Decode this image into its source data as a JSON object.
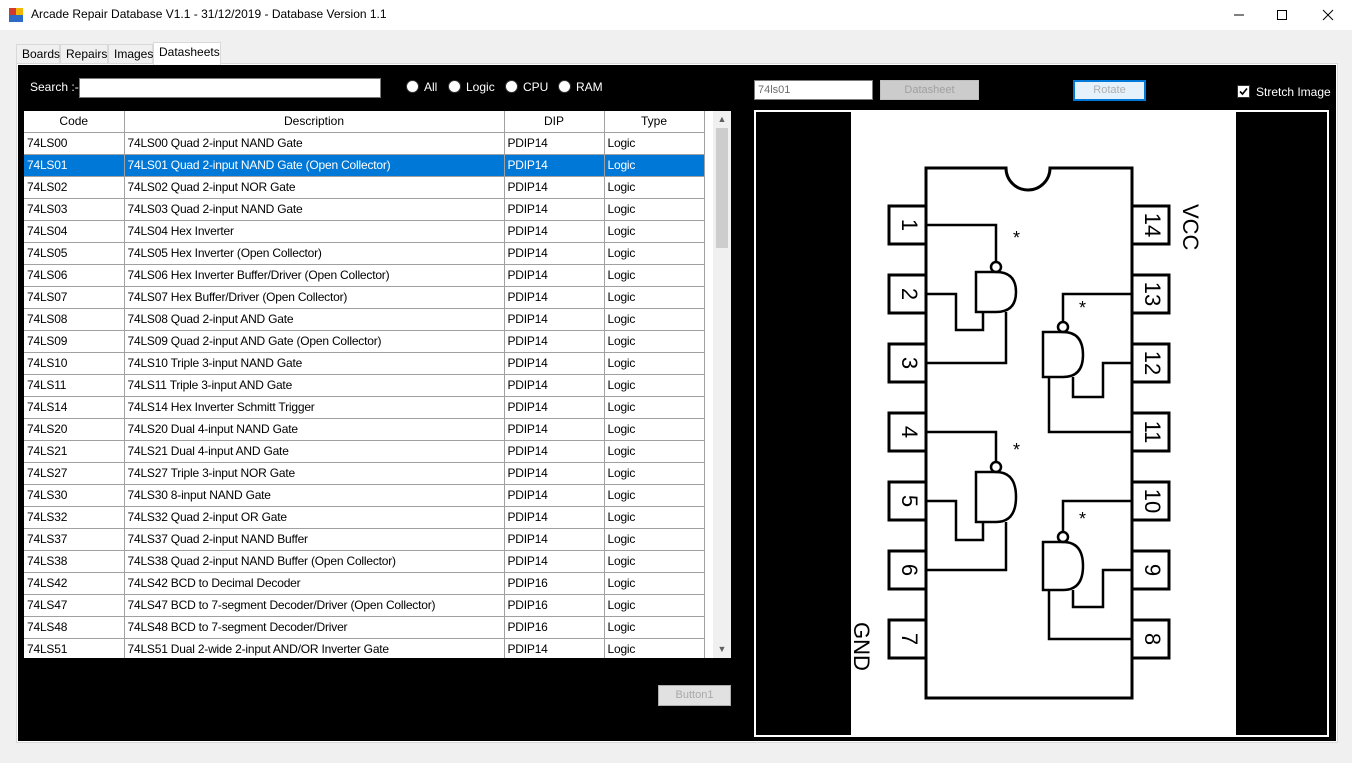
{
  "window": {
    "title": "Arcade Repair Database V1.1 - 31/12/2019 - Database Version 1.1",
    "minimize_glyph": "—",
    "maximize_glyph": "☐",
    "close_glyph": "✕"
  },
  "tabs": [
    {
      "label": "Boards",
      "active": false
    },
    {
      "label": "Repairs",
      "active": false
    },
    {
      "label": "Images",
      "active": false
    },
    {
      "label": "Datasheets",
      "active": true
    }
  ],
  "search": {
    "label": "Search :-",
    "value": ""
  },
  "filters": [
    {
      "label": "All",
      "checked": false
    },
    {
      "label": "Logic",
      "checked": false
    },
    {
      "label": "CPU",
      "checked": false
    },
    {
      "label": "RAM",
      "checked": false
    }
  ],
  "grid": {
    "columns": [
      "Code",
      "Description",
      "DIP",
      "Type"
    ],
    "selected_index": 1,
    "rows": [
      [
        "74LS00",
        "74LS00 Quad 2-input NAND Gate",
        "PDIP14",
        "Logic"
      ],
      [
        "74LS01",
        "74LS01 Quad 2-input NAND Gate (Open Collector)",
        "PDIP14",
        "Logic"
      ],
      [
        "74LS02",
        "74LS02 Quad 2-input NOR Gate",
        "PDIP14",
        "Logic"
      ],
      [
        "74LS03",
        "74LS03 Quad 2-input NAND Gate",
        "PDIP14",
        "Logic"
      ],
      [
        "74LS04",
        "74LS04 Hex Inverter",
        "PDIP14",
        "Logic"
      ],
      [
        "74LS05",
        "74LS05 Hex Inverter (Open Collector)",
        "PDIP14",
        "Logic"
      ],
      [
        "74LS06",
        "74LS06 Hex Inverter Buffer/Driver (Open Collector)",
        "PDIP14",
        "Logic"
      ],
      [
        "74LS07",
        "74LS07 Hex Buffer/Driver (Open Collector)",
        "PDIP14",
        "Logic"
      ],
      [
        "74LS08",
        "74LS08 Quad 2-input AND Gate",
        "PDIP14",
        "Logic"
      ],
      [
        "74LS09",
        "74LS09 Quad 2-input AND Gate (Open Collector)",
        "PDIP14",
        "Logic"
      ],
      [
        "74LS10",
        "74LS10 Triple 3-input NAND Gate",
        "PDIP14",
        "Logic"
      ],
      [
        "74LS11",
        "74LS11 Triple 3-input AND Gate",
        "PDIP14",
        "Logic"
      ],
      [
        "74LS14",
        "74LS14 Hex Inverter Schmitt Trigger",
        "PDIP14",
        "Logic"
      ],
      [
        "74LS20",
        "74LS20 Dual 4-input NAND Gate",
        "PDIP14",
        "Logic"
      ],
      [
        "74LS21",
        "74LS21 Dual 4-input AND Gate",
        "PDIP14",
        "Logic"
      ],
      [
        "74LS27",
        "74LS27 Triple 3-input NOR Gate",
        "PDIP14",
        "Logic"
      ],
      [
        "74LS30",
        "74LS30 8-input NAND Gate",
        "PDIP14",
        "Logic"
      ],
      [
        "74LS32",
        "74LS32 Quad 2-input OR Gate",
        "PDIP14",
        "Logic"
      ],
      [
        "74LS37",
        "74LS37 Quad 2-input NAND Buffer",
        "PDIP14",
        "Logic"
      ],
      [
        "74LS38",
        "74LS38 Quad 2-input NAND Buffer (Open Collector)",
        "PDIP14",
        "Logic"
      ],
      [
        "74LS42",
        "74LS42 BCD to Decimal Decoder",
        "PDIP16",
        "Logic"
      ],
      [
        "74LS47",
        "74LS47 BCD to 7-segment Decoder/Driver (Open Collector)",
        "PDIP16",
        "Logic"
      ],
      [
        "74LS48",
        "74LS48 BCD to 7-segment Decoder/Driver",
        "PDIP16",
        "Logic"
      ],
      [
        "74LS51",
        "74LS51 Dual 2-wide 2-input AND/OR Inverter Gate",
        "PDIP14",
        "Logic"
      ]
    ]
  },
  "button1_label": "Button1",
  "viewer": {
    "code_value": "74ls01",
    "datasheet_label": "Datasheet",
    "rotate_label": "Rotate",
    "stretch_label": "Stretch Image",
    "stretch_checked": true,
    "chip": {
      "vcc_label": "VCC",
      "gnd_label": "GND",
      "pins_left": [
        "1",
        "2",
        "3",
        "4",
        "5",
        "6",
        "7"
      ],
      "pins_right": [
        "14",
        "13",
        "12",
        "11",
        "10",
        "9",
        "8"
      ],
      "open_collector_mark": "*"
    }
  },
  "colors": {
    "selection": "#0078d7",
    "panel_background": "#000000",
    "window_background": "#f0f0f0"
  }
}
